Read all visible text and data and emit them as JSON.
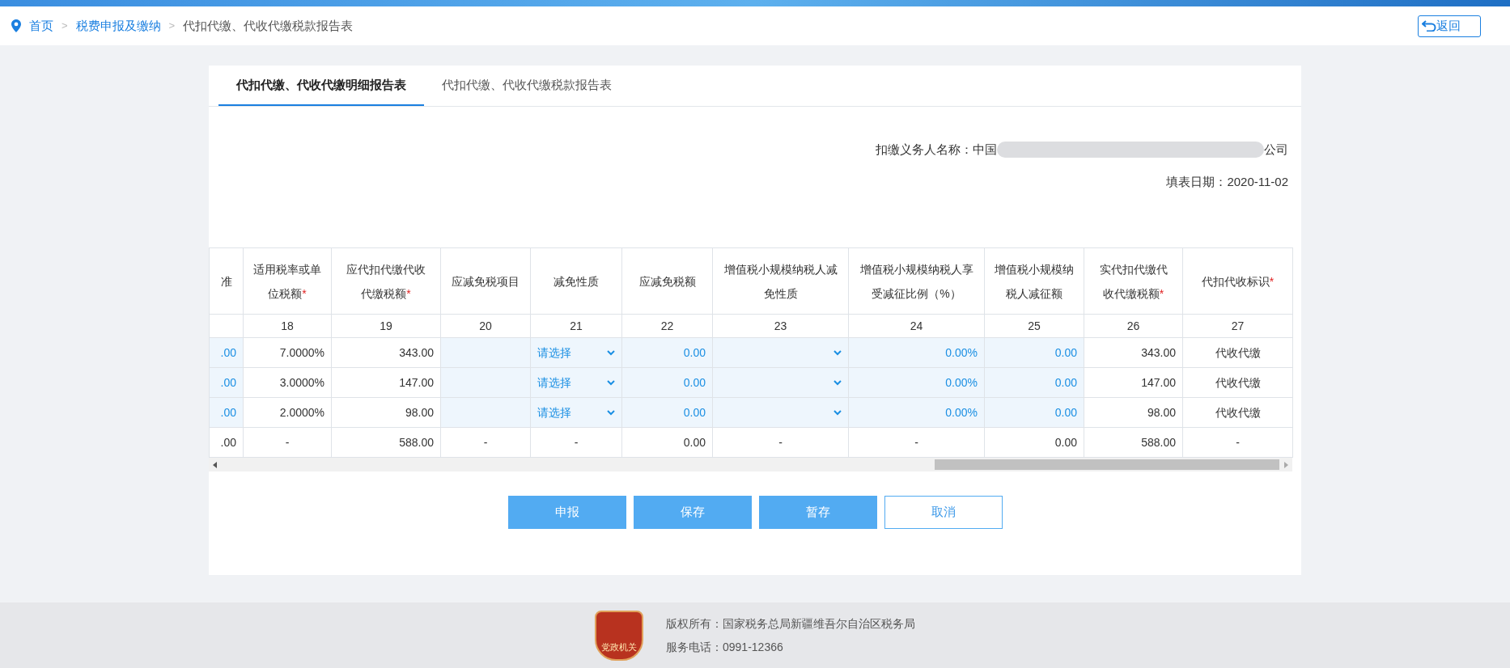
{
  "breadcrumb": [
    {
      "label": "首页",
      "link": true
    },
    {
      "separator": ">",
      "label": "税费申报及缴纳",
      "link": true
    },
    {
      "separator": ">",
      "label": "代扣代缴、代收代缴税款报告表",
      "link": false
    }
  ],
  "back_button": "返回",
  "tabs": [
    {
      "label": "代扣代缴、代收代缴明细报告表",
      "selected": true
    },
    {
      "label": "代扣代缴、代收代缴税款报告表",
      "selected": false
    }
  ],
  "agent_name": {
    "label": "扣缴义务人名称：",
    "value_start": "中国",
    "value_end": "公司"
  },
  "fill_date": {
    "label": "填表日期：",
    "value": "2020-11-02"
  },
  "table": {
    "columns": [
      {
        "label": "准"
      },
      {
        "label": "适用税率或单位税额",
        "required_mark": "*"
      },
      {
        "label": "应代扣代缴代收代缴税额",
        "required_mark": "*"
      },
      {
        "label": "应减免税项目"
      },
      {
        "label": "减免性质"
      },
      {
        "label": "应减免税额"
      },
      {
        "label": "增值税小规模纳税人减免性质"
      },
      {
        "label": "增值税小规模纳税人享受减征比例（%）"
      },
      {
        "label": "增值税小规模纳税人减征额"
      },
      {
        "label": "实代扣代缴代收代缴税额",
        "required_mark": "*"
      },
      {
        "label": "代扣代收标识",
        "required_mark": "*"
      }
    ],
    "numbers": [
      "18",
      "19",
      "20",
      "21",
      "22",
      "23",
      "24",
      "25",
      "26",
      "27"
    ],
    "rows": [
      [
        {
          "kind": "input",
          "value": ".00"
        },
        {
          "kind": "text",
          "value": "7.0000%"
        },
        {
          "kind": "text",
          "value": "343.00"
        },
        {
          "kind": "input"
        },
        {
          "kind": "select",
          "value": "请选择"
        },
        {
          "kind": "input",
          "value": "0.00"
        },
        {
          "kind": "select"
        },
        {
          "kind": "input",
          "value": "0.00%"
        },
        {
          "kind": "input",
          "value": "0.00"
        },
        {
          "kind": "text",
          "value": "343.00"
        },
        {
          "kind": "center",
          "value": "代收代缴"
        }
      ],
      [
        {
          "kind": "input",
          "value": ".00"
        },
        {
          "kind": "text",
          "value": "3.0000%"
        },
        {
          "kind": "text",
          "value": "147.00"
        },
        {
          "kind": "input"
        },
        {
          "kind": "select",
          "value": "请选择"
        },
        {
          "kind": "input",
          "value": "0.00"
        },
        {
          "kind": "select"
        },
        {
          "kind": "input",
          "value": "0.00%"
        },
        {
          "kind": "input",
          "value": "0.00"
        },
        {
          "kind": "text",
          "value": "147.00"
        },
        {
          "kind": "center",
          "value": "代收代缴"
        }
      ],
      [
        {
          "kind": "input",
          "value": ".00"
        },
        {
          "kind": "text",
          "value": "2.0000%"
        },
        {
          "kind": "text",
          "value": "98.00"
        },
        {
          "kind": "input"
        },
        {
          "kind": "select",
          "value": "请选择"
        },
        {
          "kind": "input",
          "value": "0.00"
        },
        {
          "kind": "select"
        },
        {
          "kind": "input",
          "value": "0.00%"
        },
        {
          "kind": "input",
          "value": "0.00"
        },
        {
          "kind": "text",
          "value": "98.00"
        },
        {
          "kind": "center",
          "value": "代收代缴"
        }
      ],
      [
        {
          "kind": "text",
          "value": ".00"
        },
        {
          "kind": "center",
          "value": "-"
        },
        {
          "kind": "text",
          "value": "588.00"
        },
        {
          "kind": "center",
          "value": "-"
        },
        {
          "kind": "center",
          "value": "-"
        },
        {
          "kind": "text",
          "value": "0.00"
        },
        {
          "kind": "center",
          "value": "-"
        },
        {
          "kind": "center",
          "value": "-"
        },
        {
          "kind": "text",
          "value": "0.00"
        },
        {
          "kind": "text",
          "value": "588.00"
        },
        {
          "kind": "center",
          "value": "-"
        }
      ]
    ]
  },
  "buttons": [
    {
      "label": "申报",
      "kind": "primary"
    },
    {
      "label": "保存",
      "kind": "primary"
    },
    {
      "label": "暂存",
      "kind": "primary"
    },
    {
      "label": "取消",
      "kind": "outline"
    }
  ],
  "footer": {
    "badge": "党政机关",
    "copyright": "版权所有：国家税务总局新疆维吾尔自治区税务局",
    "phone": "服务电话：0991-12366"
  }
}
